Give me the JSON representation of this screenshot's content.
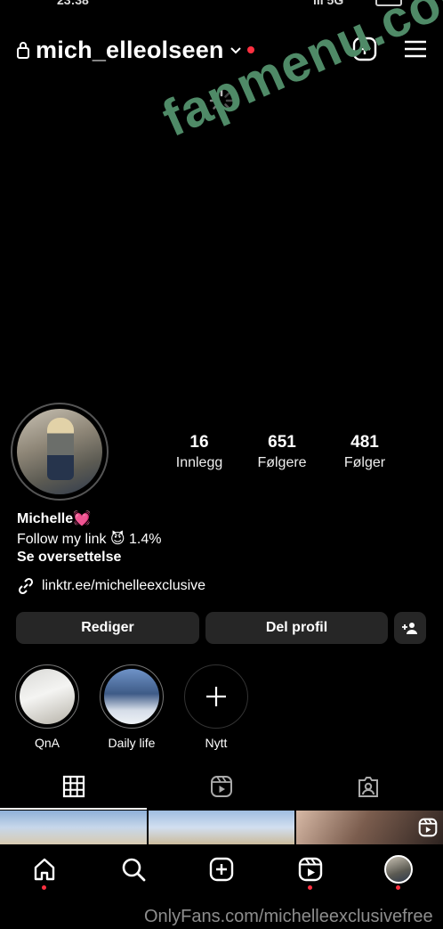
{
  "status_bar": {
    "time": "23:38",
    "signal": "lll 5G"
  },
  "header": {
    "username": "mich_elleolseen"
  },
  "watermark": "fapmenu.com",
  "stats": [
    {
      "num": "16",
      "label": "Innlegg"
    },
    {
      "num": "651",
      "label": "Følgere"
    },
    {
      "num": "481",
      "label": "Følger"
    }
  ],
  "bio": {
    "name": "Michelle💓",
    "text": "Follow my link 😈 1.4%",
    "translate": "Se oversettelse",
    "link": "linktr.ee/michelleexclusive"
  },
  "buttons": {
    "edit": "Rediger",
    "share": "Del profil"
  },
  "highlights": [
    {
      "label": "QnA"
    },
    {
      "label": "Daily life"
    },
    {
      "label": "Nytt"
    }
  ],
  "footer_watermark": "OnlyFans.com/michelleexclusivefree",
  "colors": {
    "background": "#000000",
    "button": "#262626",
    "notification": "#ff3040",
    "watermark": "#4f8a67"
  }
}
